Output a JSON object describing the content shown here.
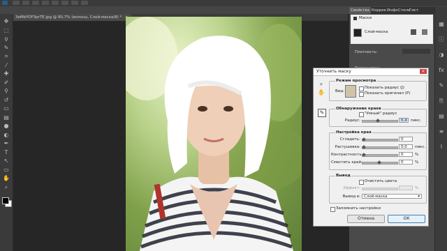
{
  "document": {
    "tab_title": "3eMbYOF3prTE.jpg @ 80,7% (волосы, Слой-маска/8) *",
    "tab_close": "×"
  },
  "toolbar": {
    "tools": [
      {
        "icon": "move-icon",
        "glyph": "✥"
      },
      {
        "icon": "marquee-icon",
        "glyph": "⬚"
      },
      {
        "icon": "lasso-icon",
        "glyph": "ϙ"
      },
      {
        "icon": "quick-select-icon",
        "glyph": "✎"
      },
      {
        "icon": "crop-icon",
        "glyph": "⌗"
      },
      {
        "icon": "eyedropper-icon",
        "glyph": "⁄"
      },
      {
        "icon": "healing-brush-icon",
        "glyph": "✚"
      },
      {
        "icon": "brush-icon",
        "glyph": "✐"
      },
      {
        "icon": "clone-stamp-icon",
        "glyph": "⚲"
      },
      {
        "icon": "history-brush-icon",
        "glyph": "↺"
      },
      {
        "icon": "eraser-icon",
        "glyph": "▭"
      },
      {
        "icon": "gradient-icon",
        "glyph": "▤"
      },
      {
        "icon": "blur-icon",
        "glyph": "●"
      },
      {
        "icon": "dodge-icon",
        "glyph": "◐"
      },
      {
        "icon": "pen-icon",
        "glyph": "✒"
      },
      {
        "icon": "type-icon",
        "glyph": "T"
      },
      {
        "icon": "path-select-icon",
        "glyph": "↖"
      },
      {
        "icon": "shape-icon",
        "glyph": "▭"
      },
      {
        "icon": "hand-icon",
        "glyph": "✋"
      },
      {
        "icon": "zoom-icon",
        "glyph": "⌕"
      }
    ]
  },
  "right_panel": {
    "tabs": [
      "Свойства",
      "Коррек",
      "Инфо",
      "Стили",
      "Гист"
    ],
    "masks_label": "Маски",
    "layer_mask_label": "Слой-маска",
    "opacity_label": "Плотность:",
    "feather_label": "Растушевка:"
  },
  "rail_icons": [
    "histogram-icon",
    "info-icon",
    "adjust-icon",
    "styles-icon",
    "brush-preset-icon",
    "clone-source-icon",
    "layers-icon",
    "channels-icon",
    "paths-icon"
  ],
  "dialog": {
    "title": "Уточнить маску",
    "close": "×",
    "tools": [
      {
        "icon": "zoom-tool-icon",
        "glyph": "⌕"
      },
      {
        "icon": "hand-tool-icon",
        "glyph": "✋"
      },
      {
        "icon": "refine-radius-tool-icon",
        "glyph": "✎"
      }
    ],
    "view_mode": {
      "heading": "Режим просмотра",
      "view_label": "Вид:",
      "show_radius": "Показать радиус (J)",
      "show_original": "Показать оригинал (P)"
    },
    "edge_detection": {
      "heading": "Обнаружение краев",
      "smart_radius": "\"Умный\" радиус",
      "radius_label": "Радиус:",
      "radius_value": "0,4",
      "radius_unit": "пикс."
    },
    "adjust_edge": {
      "heading": "Настройка края",
      "rows": [
        {
          "label": "Сгладить:",
          "value": "0",
          "unit": ""
        },
        {
          "label": "Растушевка:",
          "value": "0,0",
          "unit": "пикс."
        },
        {
          "label": "Контрастность:",
          "value": "0",
          "unit": "%"
        },
        {
          "label": "Сместить край:",
          "value": "0",
          "unit": "%"
        }
      ]
    },
    "output": {
      "heading": "Вывод",
      "decontaminate": "Очистить цвета",
      "amount_label": "Эффект:",
      "amount_unit": "%",
      "output_to_label": "Вывод в:",
      "output_to_value": "Слой-маска"
    },
    "remember_settings": "Запомнить настройки",
    "cancel": "Отмена",
    "ok": "ОК"
  }
}
